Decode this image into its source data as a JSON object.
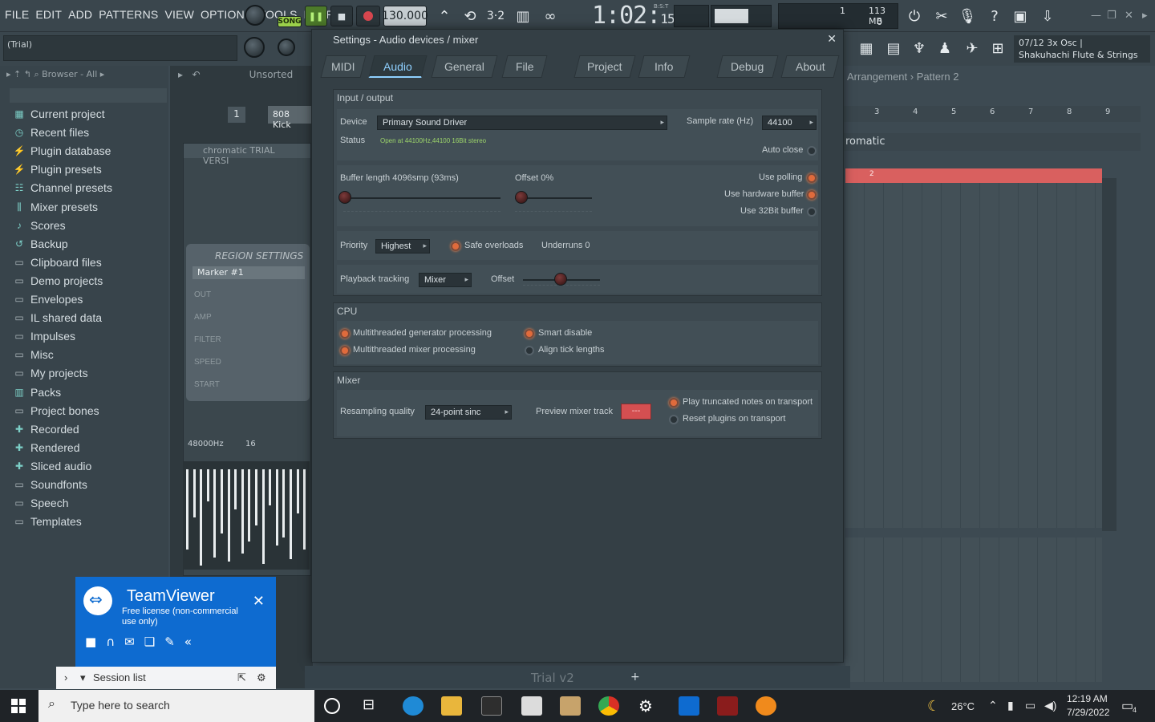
{
  "menu": [
    "FILE",
    "EDIT",
    "ADD",
    "PATTERNS",
    "VIEW",
    "OPTIONS",
    "TOOLS",
    "HELP"
  ],
  "transport": {
    "song_label": "SONG",
    "tempo": "130.000",
    "time": "1:02",
    "time_small": "15",
    "bst_label": "B:S:T",
    "mem_top": "1",
    "mem_value": "113 MB",
    "mem_bottom": "0"
  },
  "hint_text": "(Trial)",
  "hint_panel": {
    "line1": "07/12  3x Osc |",
    "line2": "Shakuhachi Flute & Strings"
  },
  "browser": {
    "header": "Browser - All",
    "items": [
      {
        "label": "Current project",
        "icon": "project-icon"
      },
      {
        "label": "Recent files",
        "icon": "recent-icon"
      },
      {
        "label": "Plugin database",
        "icon": "plug-icon"
      },
      {
        "label": "Plugin presets",
        "icon": "plug-icon"
      },
      {
        "label": "Channel presets",
        "icon": "channel-icon"
      },
      {
        "label": "Mixer presets",
        "icon": "mixer-icon"
      },
      {
        "label": "Scores",
        "icon": "note-icon"
      },
      {
        "label": "Backup",
        "icon": "backup-icon"
      },
      {
        "label": "Clipboard files",
        "icon": "folder-icon"
      },
      {
        "label": "Demo projects",
        "icon": "folder-icon"
      },
      {
        "label": "Envelopes",
        "icon": "folder-icon"
      },
      {
        "label": "IL shared data",
        "icon": "folder-icon"
      },
      {
        "label": "Impulses",
        "icon": "folder-icon"
      },
      {
        "label": "Misc",
        "icon": "folder-icon"
      },
      {
        "label": "My projects",
        "icon": "folder-icon"
      },
      {
        "label": "Packs",
        "icon": "packs-icon"
      },
      {
        "label": "Project bones",
        "icon": "folder-icon"
      },
      {
        "label": "Recorded",
        "icon": "recorded-icon"
      },
      {
        "label": "Rendered",
        "icon": "rendered-icon"
      },
      {
        "label": "Sliced audio",
        "icon": "sliced-icon"
      },
      {
        "label": "Soundfonts",
        "icon": "folder-icon"
      },
      {
        "label": "Speech",
        "icon": "folder-icon"
      },
      {
        "label": "Templates",
        "icon": "folder-icon"
      }
    ]
  },
  "channel_rack": {
    "header": "Unsorted",
    "channel_num": "1",
    "channel_name": "808 Kick",
    "plugin_title": "chromatic TRIAL VERSI",
    "region_title": "REGION SETTINGS",
    "marker": "Marker #1",
    "rows": [
      "OUT",
      "AMP",
      "FILTER",
      "SPEED",
      "START"
    ],
    "sample_rate": "48000Hz",
    "format": "16"
  },
  "dialog": {
    "title": "Settings - Audio devices / mixer",
    "tabs": [
      "MIDI",
      "Audio",
      "General",
      "File",
      "Project",
      "Info",
      "Debug",
      "About"
    ],
    "active_tab": "Audio",
    "io": {
      "title": "Input / output",
      "device_label": "Device",
      "device_value": "Primary Sound Driver",
      "sample_rate_label": "Sample rate (Hz)",
      "sample_rate_value": "44100",
      "status_label": "Status",
      "status_value": "Open at 44100Hz,44100 16Bit stereo",
      "auto_close": "Auto close",
      "buffer_label": "Buffer length 4096smp (93ms)",
      "offset_label": "Offset 0%",
      "use_polling": "Use polling",
      "use_hw_buffer": "Use hardware buffer",
      "use_32bit": "Use 32Bit buffer",
      "priority_label": "Priority",
      "priority_value": "Highest",
      "safe_overloads": "Safe overloads",
      "underruns": "Underruns 0",
      "playback_label": "Playback tracking",
      "playback_value": "Mixer",
      "playback_offset": "Offset"
    },
    "cpu": {
      "title": "CPU",
      "multi_gen": "Multithreaded generator processing",
      "multi_mix": "Multithreaded mixer processing",
      "smart_disable": "Smart disable",
      "align_tick": "Align tick lengths"
    },
    "mixer": {
      "title": "Mixer",
      "resampling_label": "Resampling quality",
      "resampling_value": "24-point sinc",
      "preview_label": "Preview mixer track",
      "preview_value": "---",
      "play_truncated": "Play truncated notes on transport",
      "reset_plugins": "Reset plugins on transport"
    }
  },
  "playlist": {
    "header": "Arrangement › Pattern 2",
    "ruler": [
      "3",
      "4",
      "5",
      "6",
      "7",
      "8",
      "9"
    ],
    "piano_title": "romatic",
    "pattern_num": "2"
  },
  "bottom": {
    "trial": "Trial v2",
    "plus": "+"
  },
  "teamviewer": {
    "title": "TeamViewer",
    "subtitle": "Free license (non-commercial use only)",
    "session": "Session list"
  },
  "taskbar": {
    "search": "Type here to search",
    "weather": "26°C",
    "time": "12:19 AM",
    "date": "7/29/2022",
    "notif": "4"
  },
  "colors": {
    "accent_tab": "#8fd0ff",
    "radio_on": "#e06b3c",
    "status_ok": "#9cd46a",
    "teamviewer": "#0e6bd0"
  }
}
